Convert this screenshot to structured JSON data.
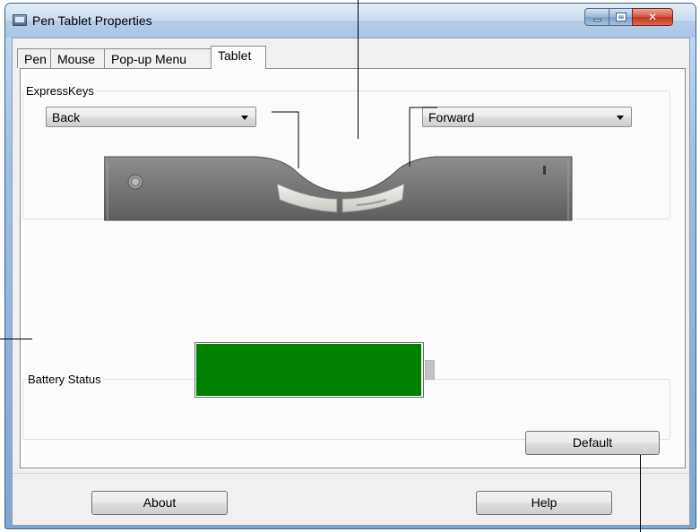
{
  "window": {
    "title": "Pen Tablet Properties",
    "controls": {
      "minimize": "minimize",
      "maximize": "maximize",
      "close": "✕"
    }
  },
  "tabs": [
    {
      "label": "Pen",
      "active": false
    },
    {
      "label": "Mouse",
      "active": false
    },
    {
      "label": "Pop-up Menu",
      "active": false
    },
    {
      "label": "Tablet",
      "active": true
    }
  ],
  "expresskeys": {
    "group_label": "ExpressKeys",
    "left_key": {
      "selected": "Back"
    },
    "right_key": {
      "selected": "Forward"
    }
  },
  "battery": {
    "group_label": "Battery Status",
    "level_fraction": 0.99,
    "fill_color": "#008000"
  },
  "buttons": {
    "default": "Default",
    "about": "About",
    "help": "Help"
  },
  "colors": {
    "titlebar_accent": "#a9c6e5",
    "close_button": "#c2361f",
    "battery_fill": "#008000"
  },
  "icons": [
    "app-window-icon",
    "minimize-icon",
    "maximize-icon",
    "close-icon",
    "dropdown-arrow-icon",
    "tablet-power-button-icon"
  ]
}
